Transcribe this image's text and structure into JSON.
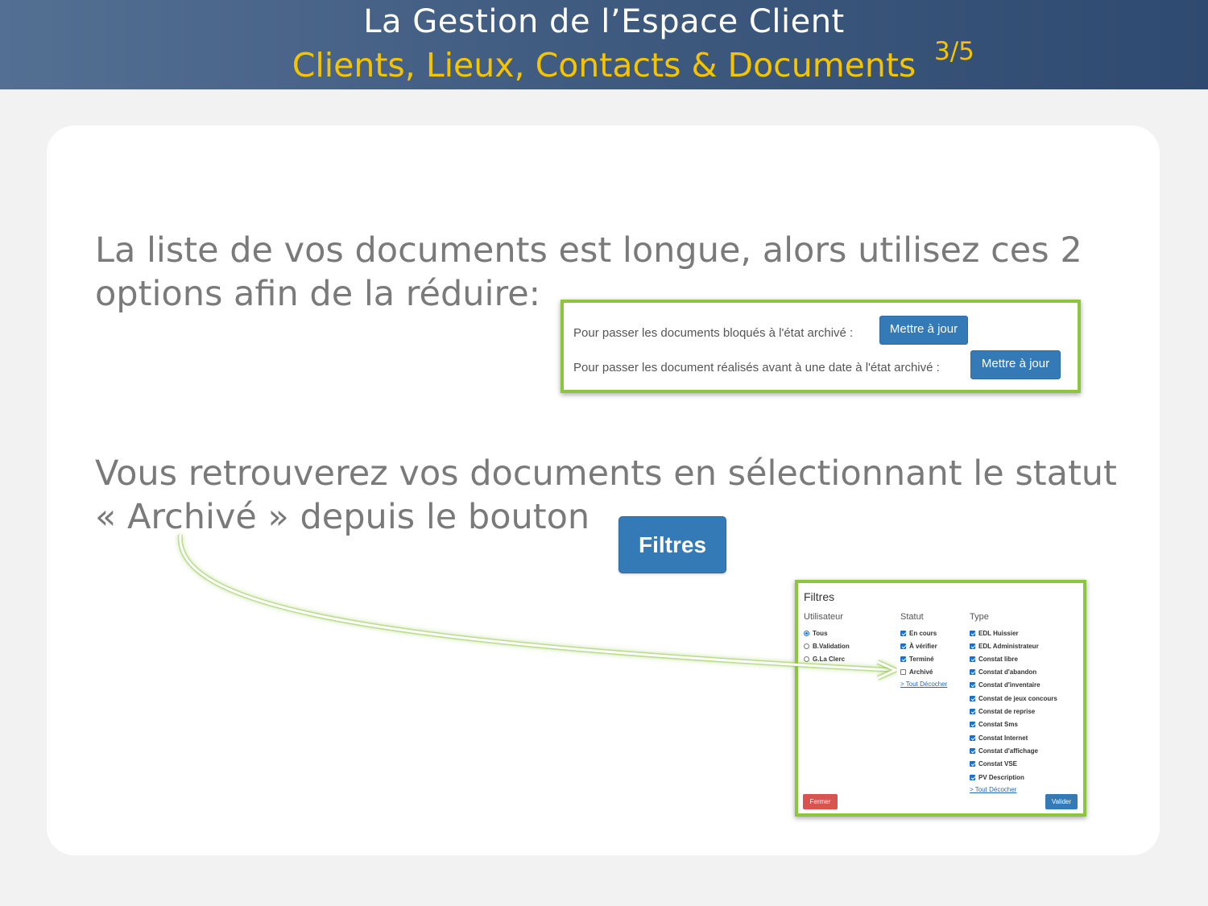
{
  "header": {
    "title": "La Gestion de l’Espace Client",
    "subtitle": "Clients, Lieux, Contacts & Documents",
    "page_counter": "3/5"
  },
  "colors": {
    "header_blue": "#3f5a7f",
    "accent_yellow": "#f5c400",
    "panel_border_green": "#8cc63f",
    "button_blue": "#337ab7",
    "button_red": "#d9534f"
  },
  "paragraph1": {
    "line1": "La liste de vos documents est longue, alors utilisez ces 2",
    "line2": "options afin de la réduire:"
  },
  "archive_panel": {
    "row1_label": "Pour passer les documents bloqués à l'état archivé :",
    "row1_button": "Mettre à jour",
    "row2_label": "Pour passer les document réalisés avant à une date à l'état archivé :",
    "row2_button": "Mettre à jour"
  },
  "paragraph2": {
    "line1": "Vous retrouverez vos documents en sélectionnant le statut",
    "line2": "« Archivé » depuis le bouton"
  },
  "filtres_button": "Filtres",
  "filters_panel": {
    "title": "Filtres",
    "user_header": "Utilisateur",
    "status_header": "Statut",
    "type_header": "Type",
    "users": [
      {
        "label": "Tous",
        "selected": true
      },
      {
        "label": "B.Validation",
        "selected": false
      },
      {
        "label": "G.La Clerc",
        "selected": false
      }
    ],
    "statuses": [
      {
        "label": "En cours",
        "checked": true
      },
      {
        "label": "À vérifier",
        "checked": true
      },
      {
        "label": "Terminé",
        "checked": true
      },
      {
        "label": "Archivé",
        "checked": false
      }
    ],
    "status_uncheck": "> Tout Décocher",
    "types": [
      {
        "label": "EDL Huissier",
        "checked": true
      },
      {
        "label": "EDL Administrateur",
        "checked": true
      },
      {
        "label": "Constat libre",
        "checked": true
      },
      {
        "label": "Constat d'abandon",
        "checked": true
      },
      {
        "label": "Constat d'inventaire",
        "checked": true
      },
      {
        "label": "Constat de jeux concours",
        "checked": true
      },
      {
        "label": "Constat de reprise",
        "checked": true
      },
      {
        "label": "Constat Sms",
        "checked": true
      },
      {
        "label": "Constat Internet",
        "checked": true
      },
      {
        "label": "Constat d'affichage",
        "checked": true
      },
      {
        "label": "Constat VSE",
        "checked": true
      },
      {
        "label": "PV Description",
        "checked": true
      }
    ],
    "type_uncheck": "> Tout Décocher",
    "close_button": "Fermer",
    "submit_button": "Valider"
  }
}
